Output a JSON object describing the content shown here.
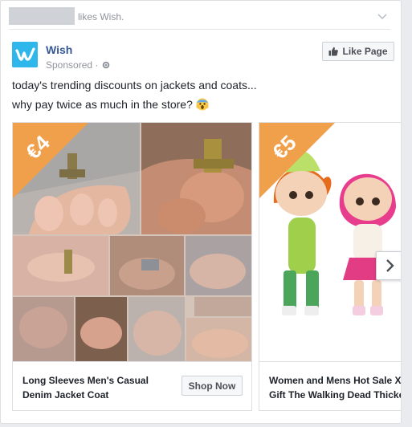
{
  "story": {
    "likes_text": "likes Wish."
  },
  "ad": {
    "page_name": "Wish",
    "sponsored": "Sponsored ·",
    "like_button": "Like Page",
    "text_line1": "today's trending discounts on jackets and coats...",
    "text_line2": "why pay twice as much in the store?"
  },
  "carousel": {
    "items": [
      {
        "price": "€4",
        "title": "Long Sleeves Men's Casual Denim Jacket Coat",
        "button": "Shop Now"
      },
      {
        "price": "€5",
        "title_line1": "Women and Mens Hot Sale Xm",
        "title_line2": "Gift The Walking Dead Thicker"
      }
    ]
  },
  "colors": {
    "brand": "#2fb7ec",
    "link": "#365899",
    "price_banner": "#f0a04b"
  },
  "icons": [
    "chevron-down-icon",
    "wish-logo",
    "globe-icon",
    "thumbs-up-icon",
    "scream-emoji-icon",
    "chevron-right-icon"
  ]
}
